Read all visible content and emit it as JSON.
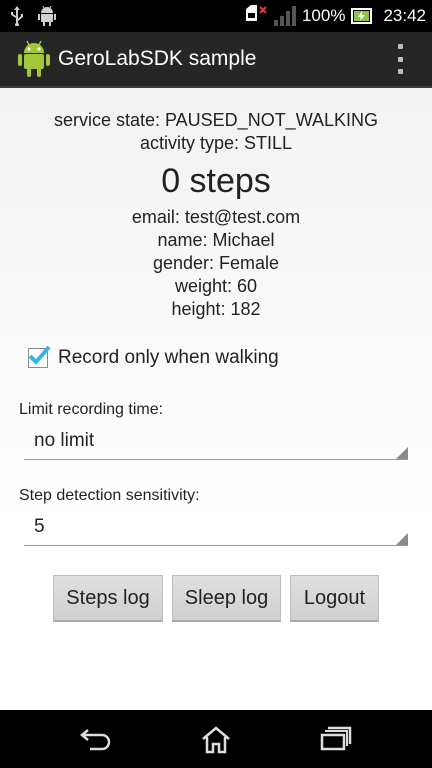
{
  "status_bar": {
    "battery": "100%",
    "time": "23:42",
    "left_icons": [
      "usb-icon",
      "android-debug-icon"
    ],
    "right_icons": [
      "sim-no-signal-icon",
      "signal-icon",
      "battery-charging-icon"
    ]
  },
  "action_bar": {
    "title": "GeroLabSDK sample",
    "icons": [
      "android-app-icon",
      "overflow-menu-icon"
    ]
  },
  "info": {
    "service_state": "service state: PAUSED_NOT_WALKING",
    "activity_type": "activity type: STILL",
    "steps": "0 steps",
    "email": "email: test@test.com",
    "name": "name: Michael",
    "gender": "gender: Female",
    "weight": "weight: 60",
    "height": "height: 182"
  },
  "record_walking": {
    "label": "Record only when walking",
    "checked": true
  },
  "limit_recording": {
    "label": "Limit recording time:",
    "value": "no limit"
  },
  "sensitivity": {
    "label": "Step detection sensitivity:",
    "value": "5"
  },
  "buttons": {
    "steps_log": "Steps log",
    "sleep_log": "Sleep log",
    "logout": "Logout"
  },
  "nav_bar": {
    "icons": [
      "back-icon",
      "home-icon",
      "recent-apps-icon"
    ]
  },
  "colors": {
    "accent": "#33b5e5",
    "action_bar": "#262626"
  }
}
